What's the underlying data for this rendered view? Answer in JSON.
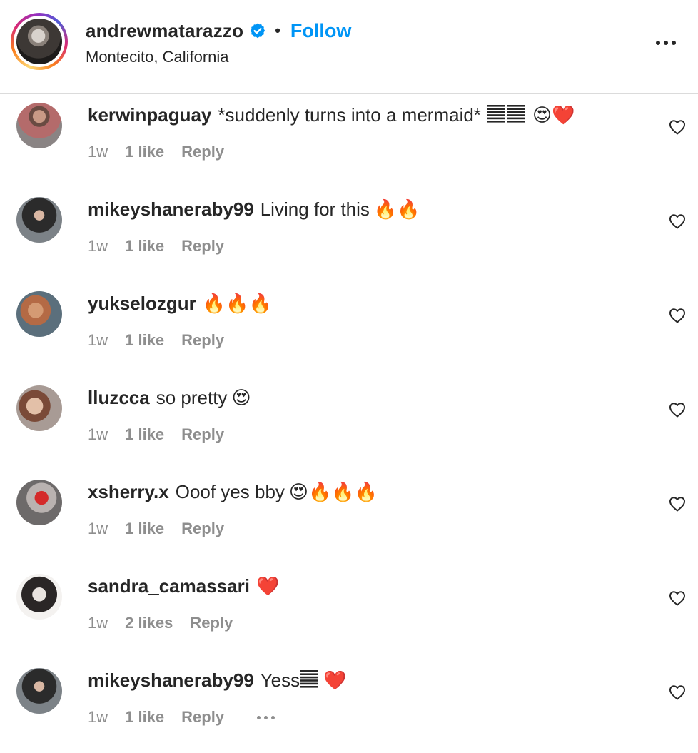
{
  "post": {
    "username": "andrewmatarazzo",
    "verified_icon": "verified-badge-icon",
    "separator": "•",
    "follow_label": "Follow",
    "location": "Montecito, California",
    "accent_color": "#0095f6"
  },
  "comments": [
    {
      "username": "kerwinpaguay",
      "text": "*suddenly turns into a mermaid*",
      "emoji": "😍❤️",
      "time": "1w",
      "likes": "1 like",
      "reply": "Reply"
    },
    {
      "username": "mikeyshaneraby99",
      "text": "Living for this",
      "emoji": "🔥🔥",
      "time": "1w",
      "likes": "1 like",
      "reply": "Reply"
    },
    {
      "username": "yukselozgur",
      "text": "",
      "emoji": "🔥🔥🔥",
      "time": "1w",
      "likes": "1 like",
      "reply": "Reply"
    },
    {
      "username": "lluzcca",
      "text": "so pretty",
      "emoji": "😍",
      "time": "1w",
      "likes": "1 like",
      "reply": "Reply"
    },
    {
      "username": "xsherry.x",
      "text": "Ooof yes bby",
      "emoji": "😍🔥🔥🔥",
      "time": "1w",
      "likes": "1 like",
      "reply": "Reply"
    },
    {
      "username": "sandra_camassari",
      "text": "",
      "emoji": "❤️",
      "time": "1w",
      "likes": "2 likes",
      "reply": "Reply"
    },
    {
      "username": "mikeyshaneraby99",
      "text": "Yess",
      "emoji": "❤️",
      "time": "1w",
      "likes": "1 like",
      "reply": "Reply"
    }
  ],
  "icons": {
    "more_options": "more-horizontal-icon",
    "like": "heart-outline-icon",
    "bars_glyph": "glyph-placeholder-icon"
  }
}
